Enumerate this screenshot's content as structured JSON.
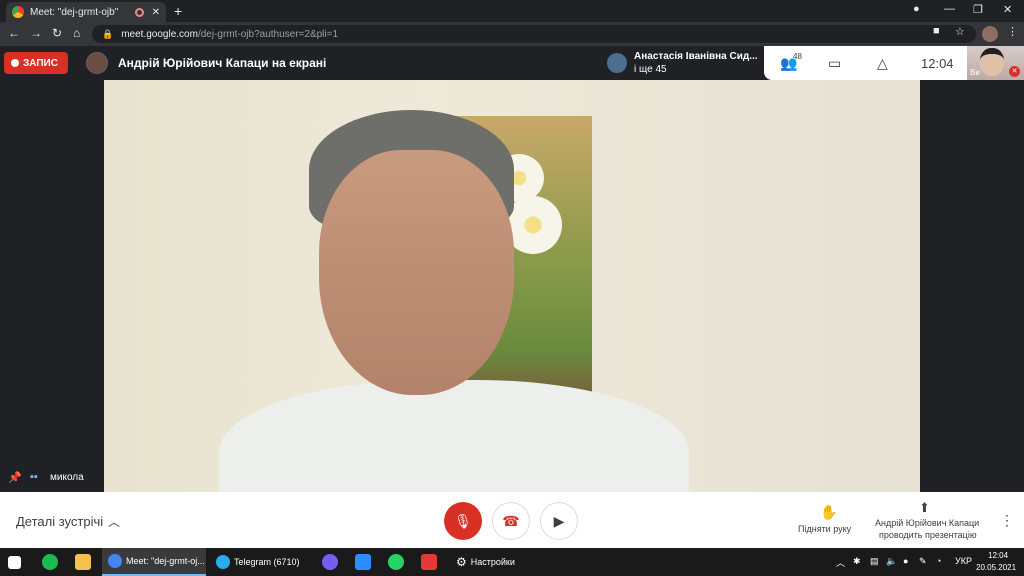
{
  "browser": {
    "tab_title": "Meet: \"dej-grmt-ojb\"",
    "tab_close": "✕",
    "new_tab": "+",
    "url_host": "meet.google.com",
    "url_path": "/dej-grmt-ojb?authuser=2&pli=1",
    "window_controls": [
      "—",
      "❐",
      "✕"
    ],
    "nav": [
      "←",
      "→",
      "↻",
      "⌂"
    ]
  },
  "meet_header": {
    "record_label": "ЗАПИС",
    "presenter_title": "Андрій Юрійович Капаци на екрані",
    "attendee_name": "Анастасія Іванівна Сид...",
    "attendee_more": "і ще 45",
    "people_count": "48",
    "time": "12:04",
    "self_label": "Ви"
  },
  "main_tile": {
    "participant_name": "микола"
  },
  "controls": {
    "details_label": "Деталі зустрічі",
    "raise_hand_label": "Підняти руку",
    "presenter_line1": "Андрій Юрійович Капаци",
    "presenter_line2": "проводить презентацію"
  },
  "taskbar": {
    "apps": [
      {
        "label": "Meet: \"dej-grmt-oj...",
        "color": "#4285f4"
      },
      {
        "label": "Telegram (6710)",
        "color": "#2aabee"
      },
      {
        "label": "Настройки",
        "color": "#ffffff"
      }
    ],
    "language": "УКР",
    "clock_time": "12:04",
    "clock_date": "20.05.2021"
  },
  "icons": [
    "search-icon",
    "lock-icon",
    "people-icon",
    "chat-icon",
    "activities-icon",
    "mic-off-icon",
    "hangup-icon",
    "camera-icon",
    "hand-icon",
    "present-icon",
    "more-icon",
    "pin-icon",
    "audio-icon"
  ]
}
